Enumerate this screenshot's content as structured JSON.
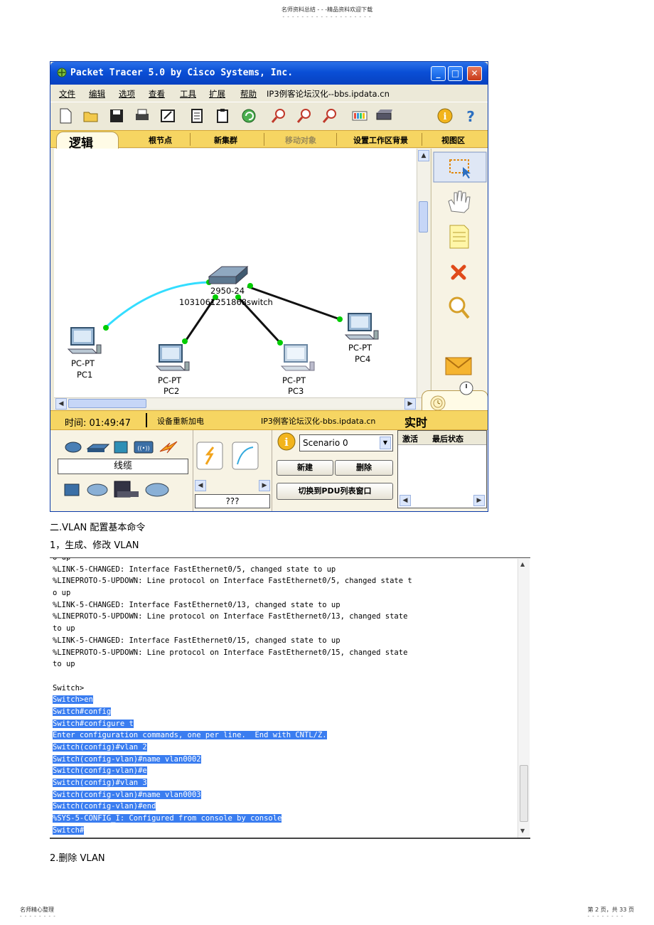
{
  "doc_header": {
    "title": "名师资料总结 - - -精品资料欢迎下载",
    "dots": "- - - - - - - - - - - - - - - - - - -"
  },
  "window": {
    "title": "Packet Tracer 5.0 by Cisco Systems, Inc.",
    "min": "_",
    "max": "□",
    "close": "✕"
  },
  "menu": {
    "items": [
      "文件",
      "编辑",
      "选项",
      "查看",
      "工具",
      "扩展",
      "帮助"
    ],
    "extra": "IP3例客论坛汉化--bbs.ipdata.cn"
  },
  "toolbar": {
    "icons": [
      "new-icon",
      "open-icon",
      "save-icon",
      "print-icon",
      "wizard-icon",
      "copy-icon",
      "paste-icon",
      "undo-icon",
      "zoom-in-icon",
      "zoom-reset-icon",
      "zoom-out-icon",
      "palette-icon",
      "device-icon",
      "info-icon",
      "help-icon"
    ]
  },
  "modebar": {
    "logic": "逻辑",
    "items": [
      "根节点",
      "新集群",
      "移动对象",
      "设置工作区背景",
      "视图区"
    ]
  },
  "topology": {
    "switch": {
      "label_line1": "2950-24",
      "label_line2": "1031061251868switch"
    },
    "pcs": [
      {
        "type": "PC-PT",
        "name": "PC1"
      },
      {
        "type": "PC-PT",
        "name": "PC2"
      },
      {
        "type": "PC-PT",
        "name": "PC3"
      },
      {
        "type": "PC-PT",
        "name": "PC4"
      }
    ]
  },
  "status": {
    "time": "时间: 01:49:47",
    "power": "设备重新加电",
    "site": "IP3例客论坛汉化-bbs.ipdata.cn",
    "realtime": "实时"
  },
  "bottom": {
    "category": "线缆",
    "unknown": "???",
    "scenario": "Scenario 0",
    "new_btn": "新建",
    "delete_btn": "删除",
    "switch_pdu_btn": "切换到PDU列表窗口",
    "col_active": "激活",
    "col_last_status": "最后状态"
  },
  "captions": {
    "section": "二.VLAN  配置基本命令",
    "step1": "1，生成、修改   VLAN",
    "step2": "2.删除  VLAN"
  },
  "terminal": {
    "lines": [
      {
        "text": "o up",
        "hl": false
      },
      {
        "text": "%LINK-5-CHANGED: Interface FastEthernet0/5, changed state to up",
        "hl": false
      },
      {
        "text": "%LINEPROTO-5-UPDOWN: Line protocol on Interface FastEthernet0/5, changed state t",
        "hl": false
      },
      {
        "text": "o up",
        "hl": false
      },
      {
        "text": "%LINK-5-CHANGED: Interface FastEthernet0/13, changed state to up",
        "hl": false
      },
      {
        "text": "%LINEPROTO-5-UPDOWN: Line protocol on Interface FastEthernet0/13, changed state",
        "hl": false
      },
      {
        "text": "to up",
        "hl": false
      },
      {
        "text": "%LINK-5-CHANGED: Interface FastEthernet0/15, changed state to up",
        "hl": false
      },
      {
        "text": "%LINEPROTO-5-UPDOWN: Line protocol on Interface FastEthernet0/15, changed state",
        "hl": false
      },
      {
        "text": "to up",
        "hl": false
      },
      {
        "text": "",
        "hl": false
      },
      {
        "text": "Switch>",
        "hl": false
      },
      {
        "text": "Switch>en",
        "hl": true
      },
      {
        "text": "Switch#config",
        "hl": true
      },
      {
        "text": "Switch#configure t",
        "hl": true
      },
      {
        "text": "Enter configuration commands, one per line.  End with CNTL/Z.",
        "hl": true
      },
      {
        "text": "Switch(config)#vlan 2",
        "hl": true
      },
      {
        "text": "Switch(config-vlan)#name vlan0002",
        "hl": true
      },
      {
        "text": "Switch(config-vlan)#e",
        "hl": true
      },
      {
        "text": "Switch(config)#vlan 3",
        "hl": true
      },
      {
        "text": "Switch(config-vlan)#name vlan0003",
        "hl": true
      },
      {
        "text": "Switch(config-vlan)#end",
        "hl": true
      },
      {
        "text": "%SYS-5-CONFIG_I: Configured from console by console",
        "hl": true
      },
      {
        "text": "Switch#",
        "hl": true
      }
    ]
  },
  "footer": {
    "left": "名师精心整理",
    "right": "第 2 页，共 33 页",
    "dots": "- - - - - - - -"
  },
  "colors": {
    "titlebar": "#0a4fd6",
    "modebar": "#f6d562",
    "selection": "#3a7df0",
    "link_green": "#00cc00",
    "console_cable": "#33ddff"
  }
}
